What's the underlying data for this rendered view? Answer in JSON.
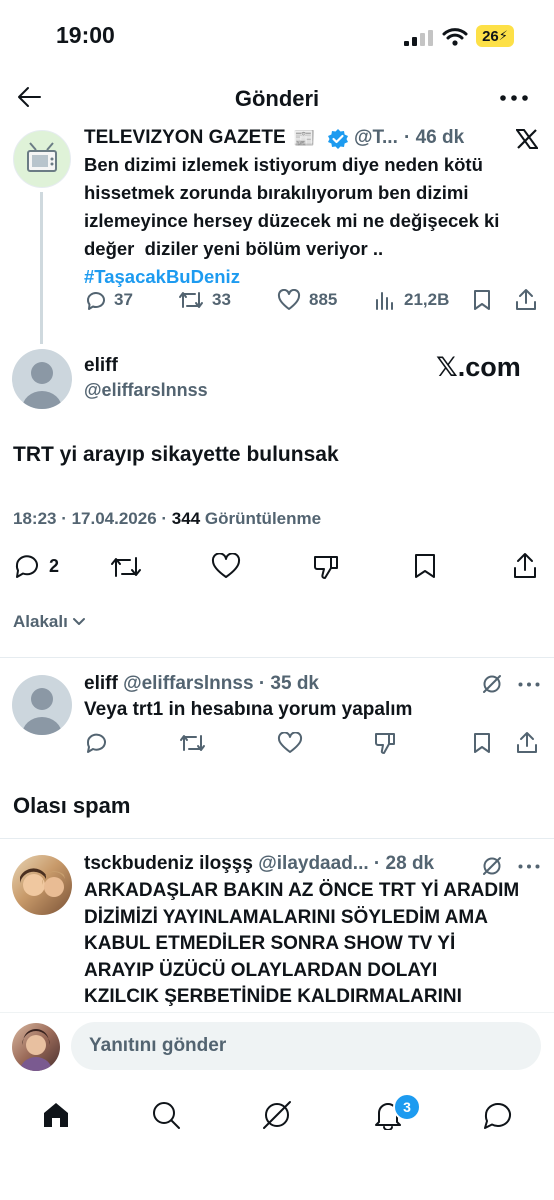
{
  "status": {
    "time": "19:00",
    "battery": "26"
  },
  "header": {
    "title": "Gönderi"
  },
  "quoted": {
    "name": "TELEVIZYON GAZETE",
    "handle": "@T...",
    "age": "· 46 dk",
    "line1": "Ben dizimi izlemek istiyorum diye neden kötü",
    "line2": "hissetmek zorunda bırakılıyorum ben dizimi",
    "line3": "izlemeyince hersey düzecek mi ne değişecek ki",
    "line4": "değer  diziler yeni bölüm veriyor ..",
    "hashtag": "#TaşacakBuDeniz",
    "replies": "37",
    "reposts": "33",
    "likes": "885",
    "views": "21,2B"
  },
  "main": {
    "name": "eliff",
    "handle": "@eliffarslnnss",
    "watermark": "𝕏.com",
    "text": "TRT yi arayıp sikayette bulunsak",
    "time": "18:23 · 17.04.2026 ·",
    "views_count": "344",
    "views_label": "Görüntülenme",
    "replies": "2"
  },
  "related": {
    "label": "Alakalı"
  },
  "reply1": {
    "name": "eliff",
    "handle": "@eliffarslnnss",
    "age": "· 35 dk",
    "text": "Veya trt1 in hesabına yorum yapalım"
  },
  "spam": {
    "label": "Olası spam"
  },
  "reply2": {
    "name": "tsckbudeniz iloşşş",
    "handle": "@ilaydaad...",
    "age": "· 28 dk",
    "line1": "ARKADAŞLAR BAKIN AZ ÖNCE TRT Yİ ARADIM",
    "line2": "DİZİMİZİ YAYINLAMALARINI SÖYLEDİM AMA",
    "line3": "KABUL ETMEDİLER SONRA SHOW TV Yİ",
    "line4": "ARAYIP ÜZÜCÜ OLAYLARDAN DOLAYI",
    "line5": "KZILCIK ŞERBETİNİDE KALDIRMALARINI"
  },
  "composer": {
    "placeholder": "Yanıtını gönder"
  },
  "tabbar": {
    "notifications_badge": "3"
  },
  "colors": {
    "accent": "#1d9bf0",
    "text": "#0f1419",
    "secondary": "#536471",
    "battery": "#fde047"
  }
}
